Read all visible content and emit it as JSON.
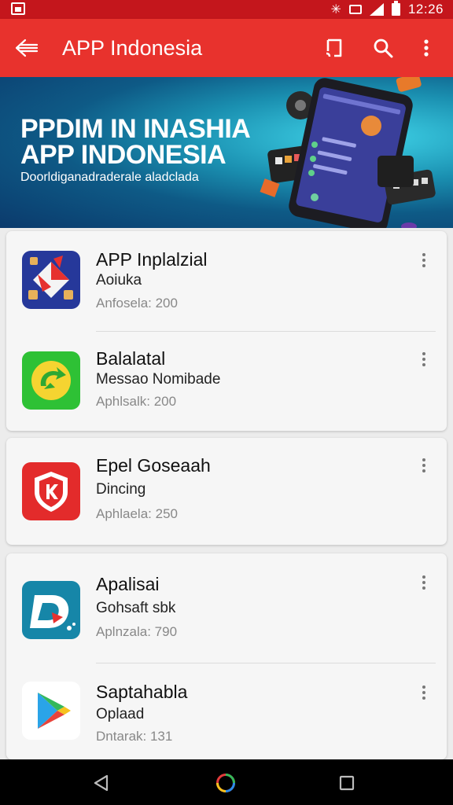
{
  "status_bar": {
    "time": "12:26",
    "icons": [
      "image-icon",
      "bluetooth-icon",
      "vibrate-icon",
      "signal-icon",
      "battery-icon"
    ],
    "color": "#c4161c"
  },
  "app_bar": {
    "title": "APP Indonesia",
    "color": "#e8322d",
    "icons": [
      "back-arrow-icon",
      "cast-icon",
      "search-icon",
      "more-vert-icon"
    ]
  },
  "banner": {
    "line1": "PPDIM IN INASHIA",
    "line2": "APP INDONESIA",
    "subtitle": "Doorldiganadraderale aladclada"
  },
  "apps": [
    {
      "title": "APP Inplalzial",
      "subtitle": "Aoiuka",
      "meta": "Anfosela: 200",
      "icon": "map-grid-icon"
    },
    {
      "title": "Balalatal",
      "subtitle": "Messao Nomibade",
      "meta": "Aphlsalk: 200",
      "icon": "green-refresh-icon"
    },
    {
      "title": "Epel Goseaah",
      "subtitle": "Dincing",
      "meta": "Aphlaela: 250",
      "icon": "shield-k-icon"
    },
    {
      "title": "Apalisai",
      "subtitle": "Gohsaft sbk",
      "meta": "Aplnzala: 790",
      "icon": "d-logo-icon"
    },
    {
      "title": "Saptahabla",
      "subtitle": "Oplaad",
      "meta": "Dntarak: 131",
      "icon": "play-store-icon"
    }
  ],
  "nav_bar": {
    "icons": [
      "nav-back-icon",
      "nav-home-icon",
      "nav-recents-icon"
    ]
  }
}
